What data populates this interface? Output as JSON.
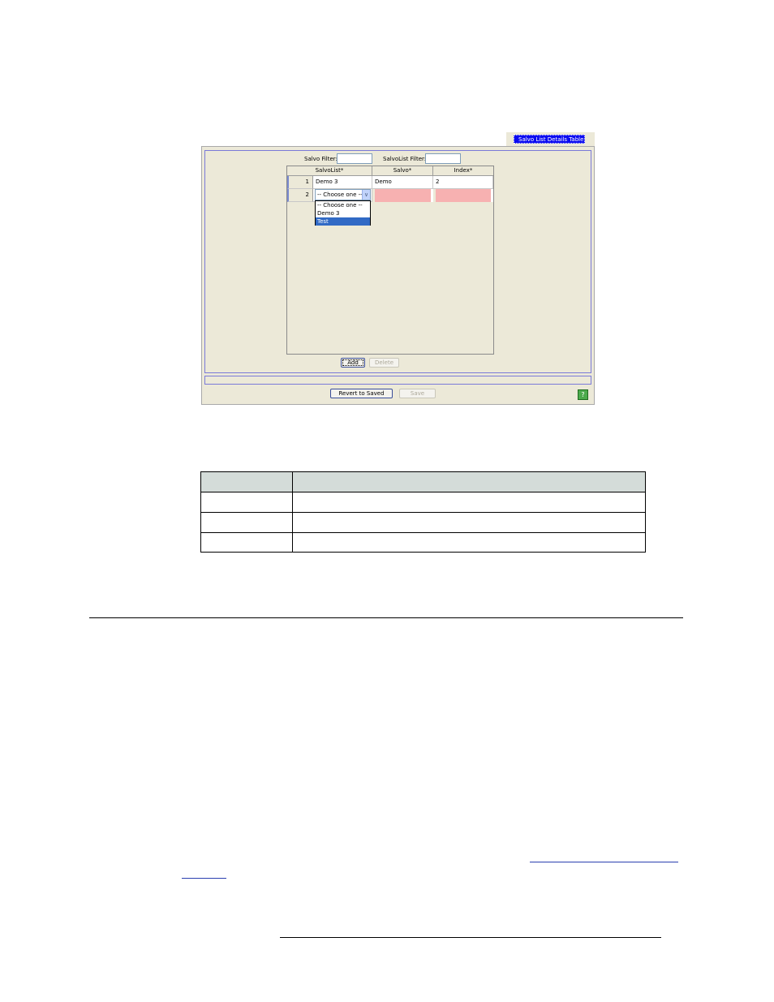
{
  "tab": {
    "label": "Salvo List Details Table"
  },
  "filters": {
    "salvo_label": "Salvo Filter:",
    "salvo_value": "",
    "salvolist_label": "SalvoList Filter:",
    "salvolist_value": ""
  },
  "grid": {
    "columns": [
      "SalvoList*",
      "Salvo*",
      "Index*"
    ],
    "rows": [
      {
        "num": "1",
        "salvolist": "Demo 3",
        "salvo": "Demo",
        "index": "2"
      },
      {
        "num": "2",
        "salvolist": "-- Choose one --",
        "salvo": "",
        "index": ""
      }
    ]
  },
  "dropdown": {
    "selected": "-- Choose one --",
    "options": [
      "-- Choose one --",
      "Demo 3",
      "Test"
    ],
    "highlighted": "Test"
  },
  "buttons": {
    "add": "Add",
    "delete": "Delete",
    "revert": "Revert to Saved",
    "save": "Save"
  },
  "icons": {
    "help": "help-icon",
    "dropdown": "chevron-down-icon"
  },
  "colors": {
    "tab_bg": "#0a0af0",
    "error_cell": "#f7b1b1",
    "selection": "#316ac5",
    "panel_bg": "#ece9d8"
  }
}
